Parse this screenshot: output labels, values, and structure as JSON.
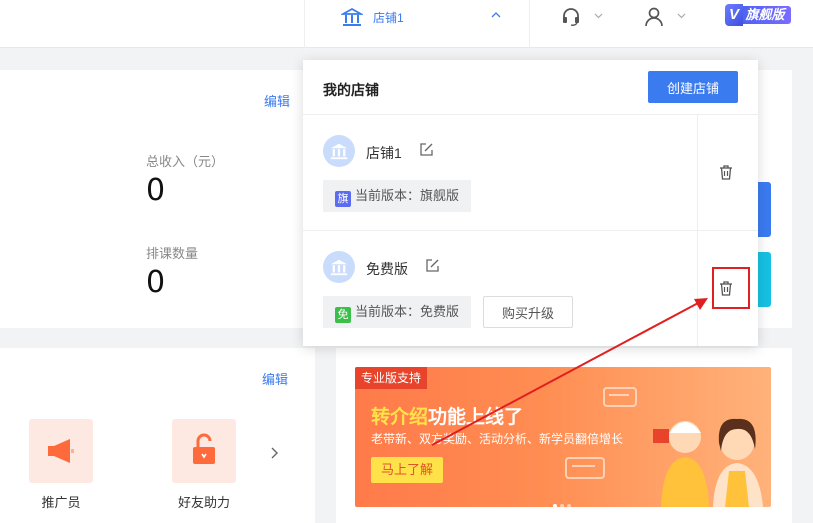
{
  "header": {
    "current_shop": "店铺1",
    "vip_badge": {
      "letter": "V",
      "label": "旗舰版"
    }
  },
  "overview": {
    "edit_label": "编辑",
    "stats": [
      {
        "label": "总收入（元）",
        "value": "0"
      },
      {
        "label": "排课数量",
        "value": "0"
      }
    ]
  },
  "tools": {
    "edit_label": "编辑",
    "items": [
      {
        "label": "推广员",
        "icon": "megaphone-icon"
      },
      {
        "label": "好友助力",
        "icon": "unlock-gift-icon"
      }
    ]
  },
  "banner": {
    "tag": "专业版支持",
    "title_highlight": "转介绍",
    "title_rest": "功能上线了",
    "subtitle": "老带新、双方奖励、活动分析、新学员翻倍增长",
    "cta": "马上了解"
  },
  "shop_dropdown": {
    "title": "我的店铺",
    "create_label": "创建店铺",
    "shops": [
      {
        "name": "店铺1",
        "version_badge": "旗",
        "version_text": "当前版本：旗舰版",
        "badge_color": "#5b6cf0"
      },
      {
        "name": "免费版",
        "version_badge": "免",
        "version_text": "当前版本：免费版",
        "badge_color": "#3cbf4a",
        "upgrade_label": "购买升级"
      }
    ]
  },
  "colors": {
    "primary": "#3a7bf0",
    "annotation": "#e02020"
  }
}
